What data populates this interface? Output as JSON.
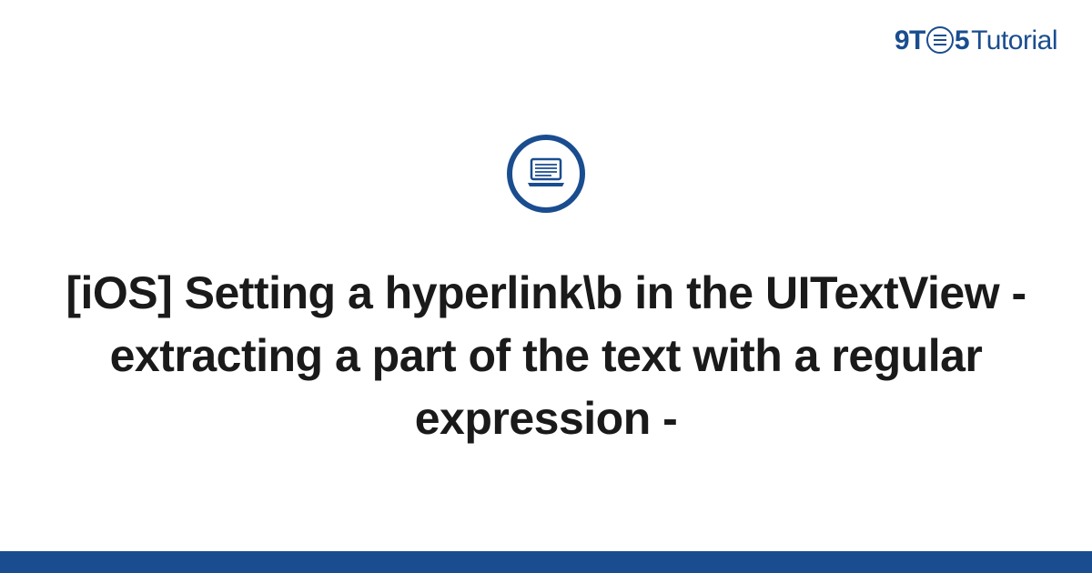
{
  "logo": {
    "part1": "9T",
    "part2": "5",
    "part3": "Tutorial"
  },
  "title": "[iOS] Setting a hyperlink\\b in the UITextView - extracting a part of the text with a regular expression -",
  "colors": {
    "brand": "#1a4d8f",
    "text": "#1a1a1a"
  }
}
